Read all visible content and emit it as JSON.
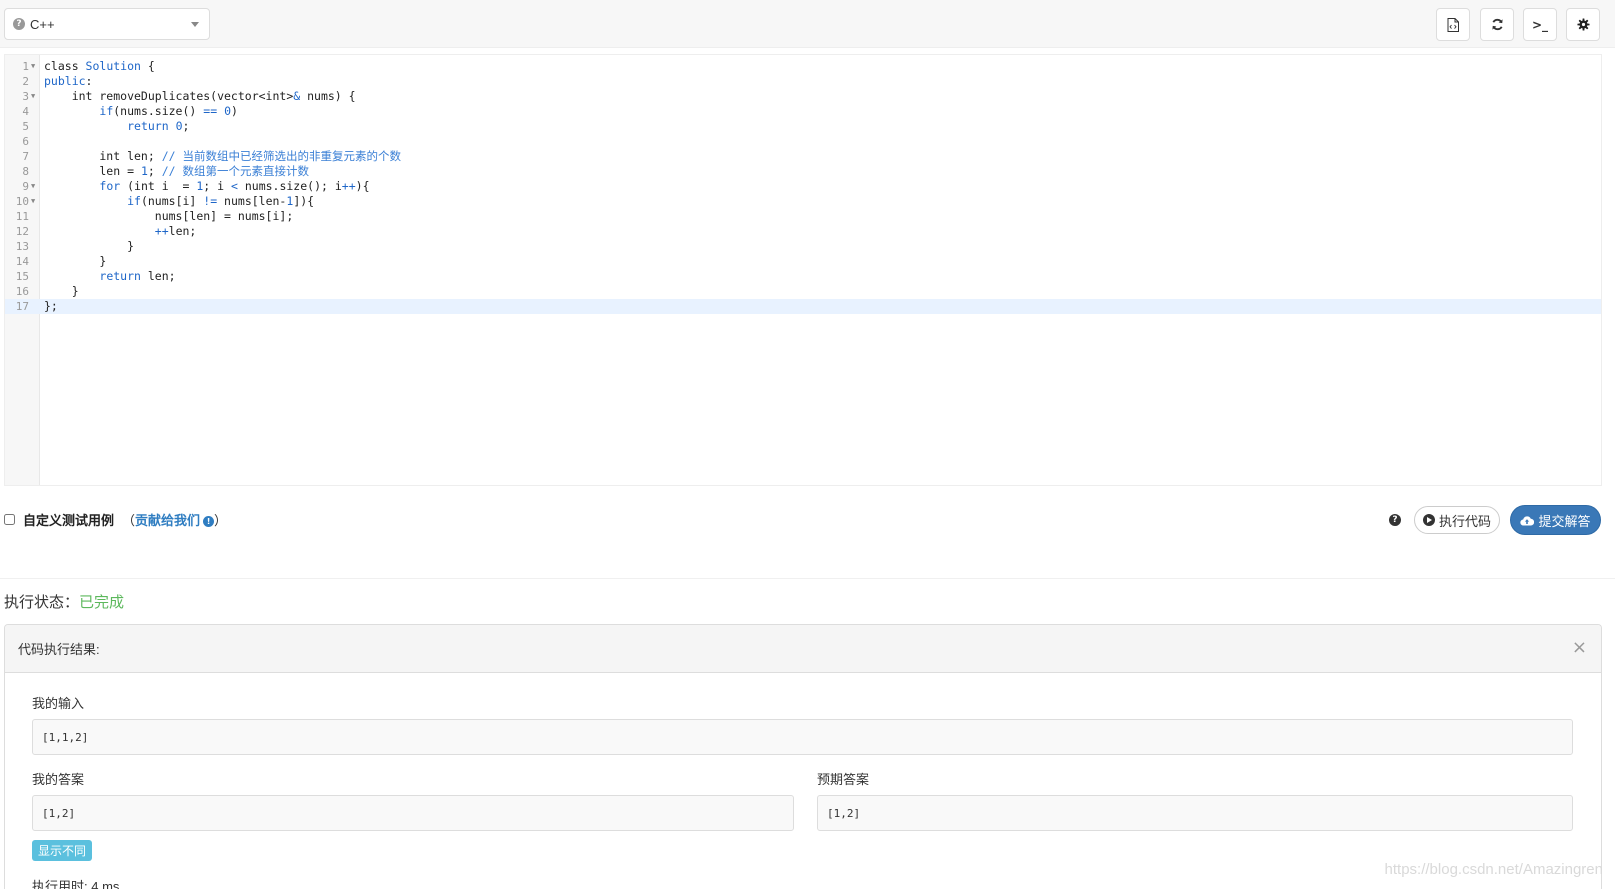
{
  "toolbar": {
    "language": "C++",
    "buttons": [
      "file-code-icon",
      "refresh-icon",
      "terminal-icon",
      "gear-icon"
    ],
    "terminal_glyph": ">_"
  },
  "editor": {
    "lines": [
      {
        "num": "1",
        "fold": true,
        "text": "class Solution {"
      },
      {
        "num": "2",
        "fold": false,
        "text": "public:"
      },
      {
        "num": "3",
        "fold": true,
        "text": "    int removeDuplicates(vector<int>& nums) {"
      },
      {
        "num": "4",
        "fold": false,
        "text": "        if(nums.size() == 0)"
      },
      {
        "num": "5",
        "fold": false,
        "text": "            return 0;"
      },
      {
        "num": "6",
        "fold": false,
        "text": ""
      },
      {
        "num": "7",
        "fold": false,
        "text": "        int len; // 当前数组中已经筛选出的非重复元素的个数"
      },
      {
        "num": "8",
        "fold": false,
        "text": "        len = 1; // 数组第一个元素直接计数"
      },
      {
        "num": "9",
        "fold": true,
        "text": "        for (int i  = 1; i < nums.size(); i++){"
      },
      {
        "num": "10",
        "fold": true,
        "text": "            if(nums[i] != nums[len-1]){"
      },
      {
        "num": "11",
        "fold": false,
        "text": "                nums[len] = nums[i];"
      },
      {
        "num": "12",
        "fold": false,
        "text": "                ++len;"
      },
      {
        "num": "13",
        "fold": false,
        "text": "            }"
      },
      {
        "num": "14",
        "fold": false,
        "text": "        }"
      },
      {
        "num": "15",
        "fold": false,
        "text": "        return len;"
      },
      {
        "num": "16",
        "fold": false,
        "text": "    }"
      },
      {
        "num": "17",
        "fold": false,
        "text": "};"
      }
    ],
    "active_line": 17
  },
  "testcase": {
    "checkbox_label": "自定义测试用例",
    "open_paren": "（",
    "contribute_link": "贡献给我们",
    "close_paren": "）"
  },
  "actions": {
    "run_label": "执行代码",
    "submit_label": "提交解答"
  },
  "status": {
    "label": "执行状态：",
    "value": "已完成"
  },
  "result": {
    "title": "代码执行结果:",
    "close_glyph": "×",
    "my_input_label": "我的输入",
    "my_input_value": "[1,1,2]",
    "my_answer_label": "我的答案",
    "my_answer_value": "[1,2]",
    "expected_label": "预期答案",
    "expected_value": "[1,2]",
    "diff_button": "显示不同",
    "exec_time": "执行用时: 4 ms"
  },
  "watermark": "https://blog.csdn.net/Amazingren",
  "colors": {
    "accent": "#3a78b7",
    "success": "#5cb85c",
    "info": "#5bc0de"
  }
}
